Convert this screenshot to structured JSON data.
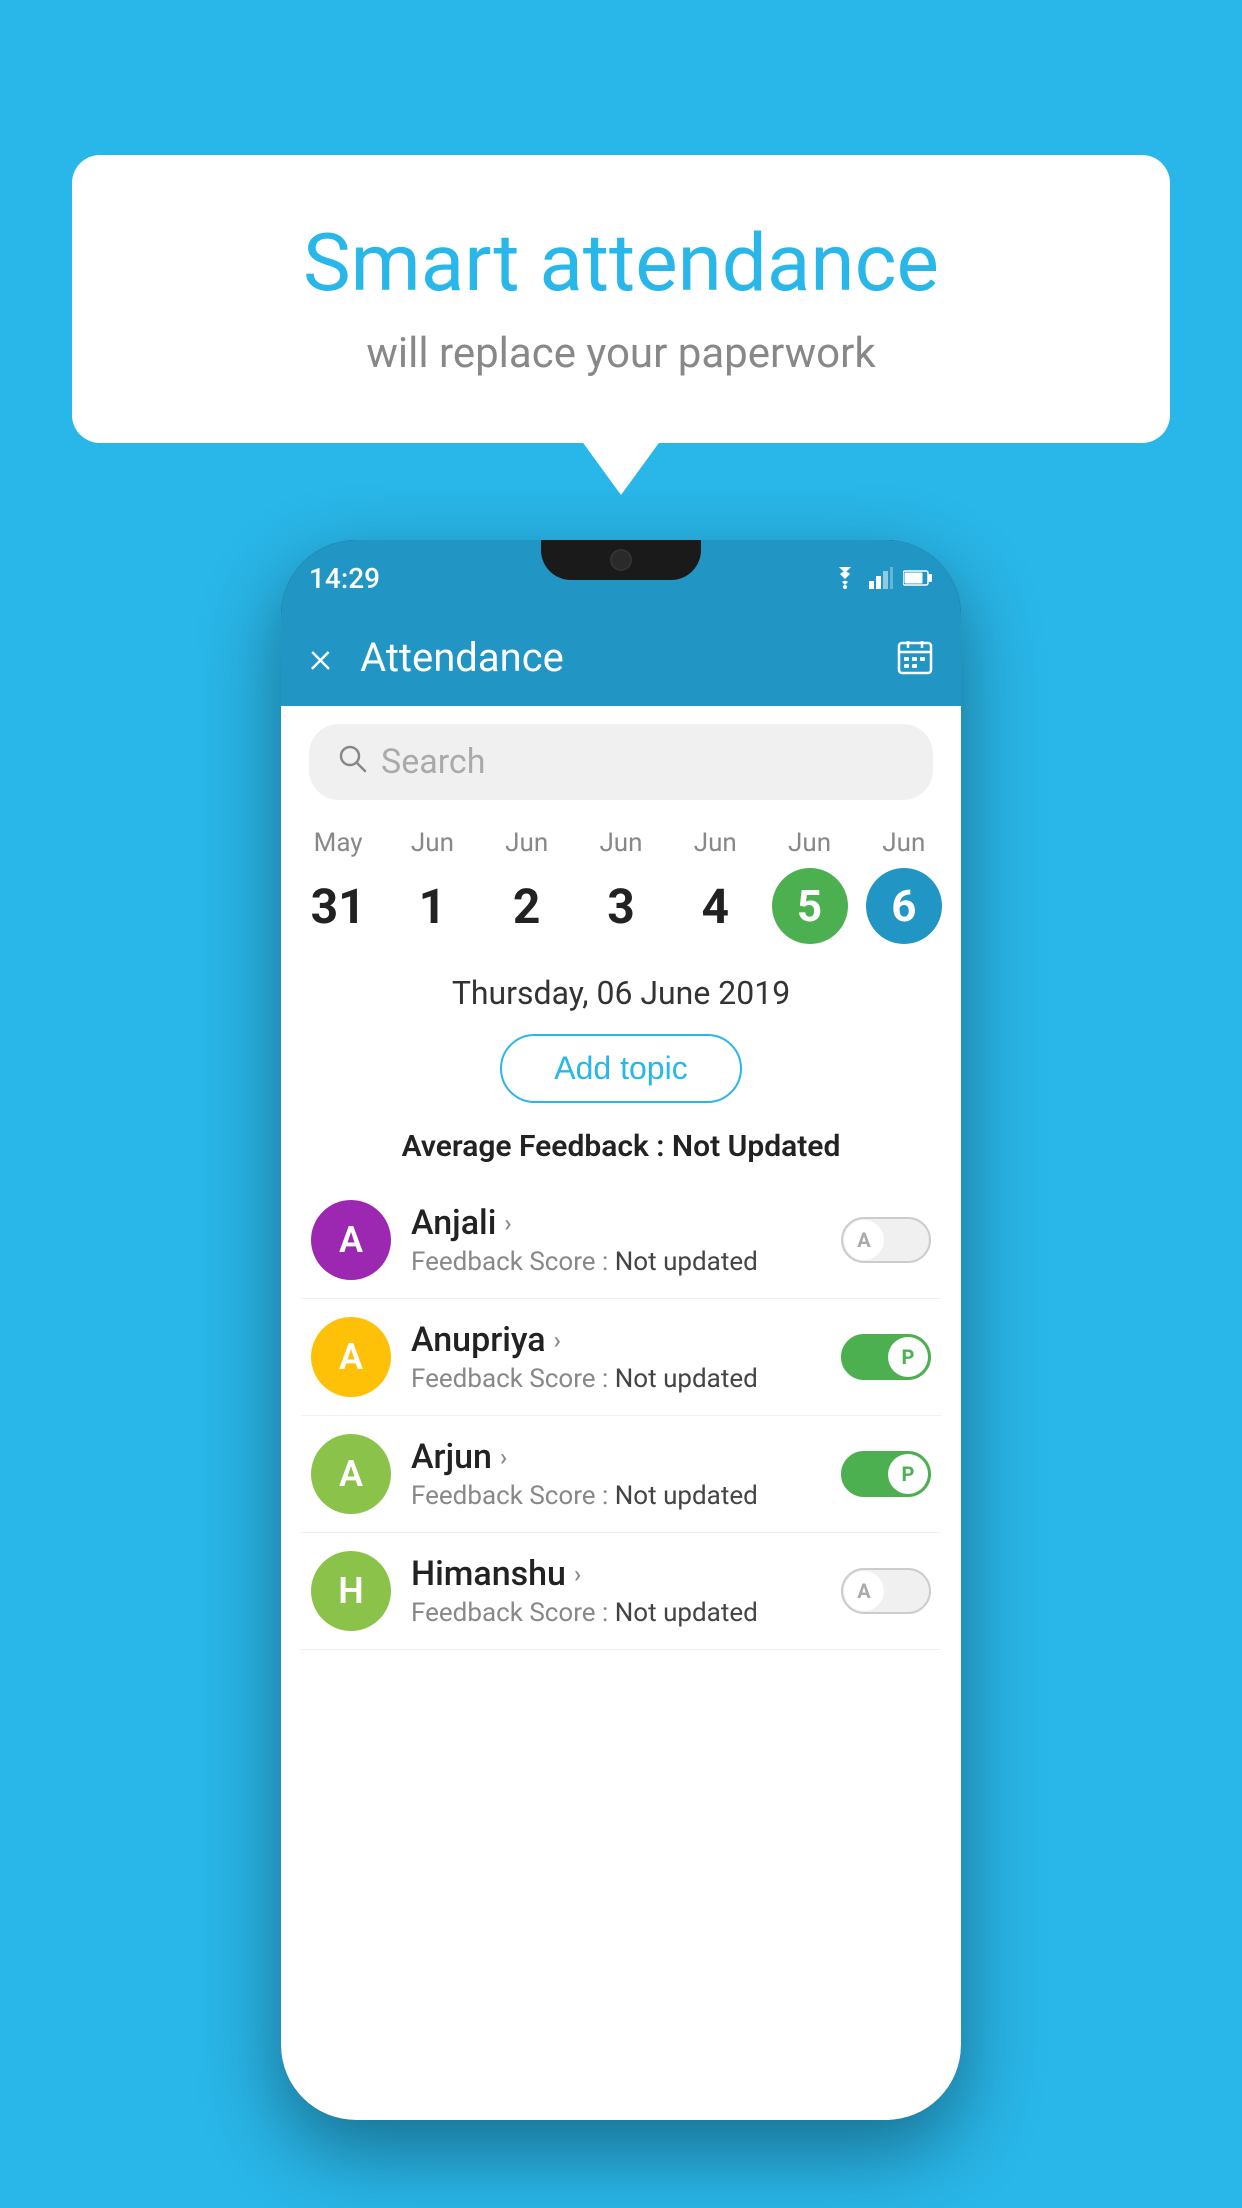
{
  "background_color": "#29b6e8",
  "bubble": {
    "title": "Smart attendance",
    "subtitle": "will replace your paperwork"
  },
  "status_bar": {
    "time": "14:29",
    "icons": [
      "wifi",
      "signal",
      "battery"
    ]
  },
  "app_bar": {
    "close_label": "×",
    "title": "Attendance",
    "calendar_label": "📅"
  },
  "search": {
    "placeholder": "Search"
  },
  "calendar": {
    "days": [
      {
        "month": "May",
        "number": "31",
        "state": "normal"
      },
      {
        "month": "Jun",
        "number": "1",
        "state": "normal"
      },
      {
        "month": "Jun",
        "number": "2",
        "state": "normal"
      },
      {
        "month": "Jun",
        "number": "3",
        "state": "normal"
      },
      {
        "month": "Jun",
        "number": "4",
        "state": "normal"
      },
      {
        "month": "Jun",
        "number": "5",
        "state": "today"
      },
      {
        "month": "Jun",
        "number": "6",
        "state": "selected"
      }
    ]
  },
  "selected_date": "Thursday, 06 June 2019",
  "add_topic_label": "Add topic",
  "avg_feedback": {
    "label": "Average Feedback : ",
    "value": "Not Updated"
  },
  "students": [
    {
      "name": "Anjali",
      "initial": "A",
      "avatar_color": "#9c27b0",
      "feedback_label": "Feedback Score : ",
      "feedback_value": "Not updated",
      "toggle_state": "off",
      "toggle_letter": "A"
    },
    {
      "name": "Anupriya",
      "initial": "A",
      "avatar_color": "#ffc107",
      "feedback_label": "Feedback Score : ",
      "feedback_value": "Not updated",
      "toggle_state": "on",
      "toggle_letter": "P"
    },
    {
      "name": "Arjun",
      "initial": "A",
      "avatar_color": "#8bc34a",
      "feedback_label": "Feedback Score : ",
      "feedback_value": "Not updated",
      "toggle_state": "on",
      "toggle_letter": "P"
    },
    {
      "name": "Himanshu",
      "initial": "H",
      "avatar_color": "#8bc34a",
      "feedback_label": "Feedback Score : ",
      "feedback_value": "Not updated",
      "toggle_state": "off",
      "toggle_letter": "A"
    }
  ]
}
